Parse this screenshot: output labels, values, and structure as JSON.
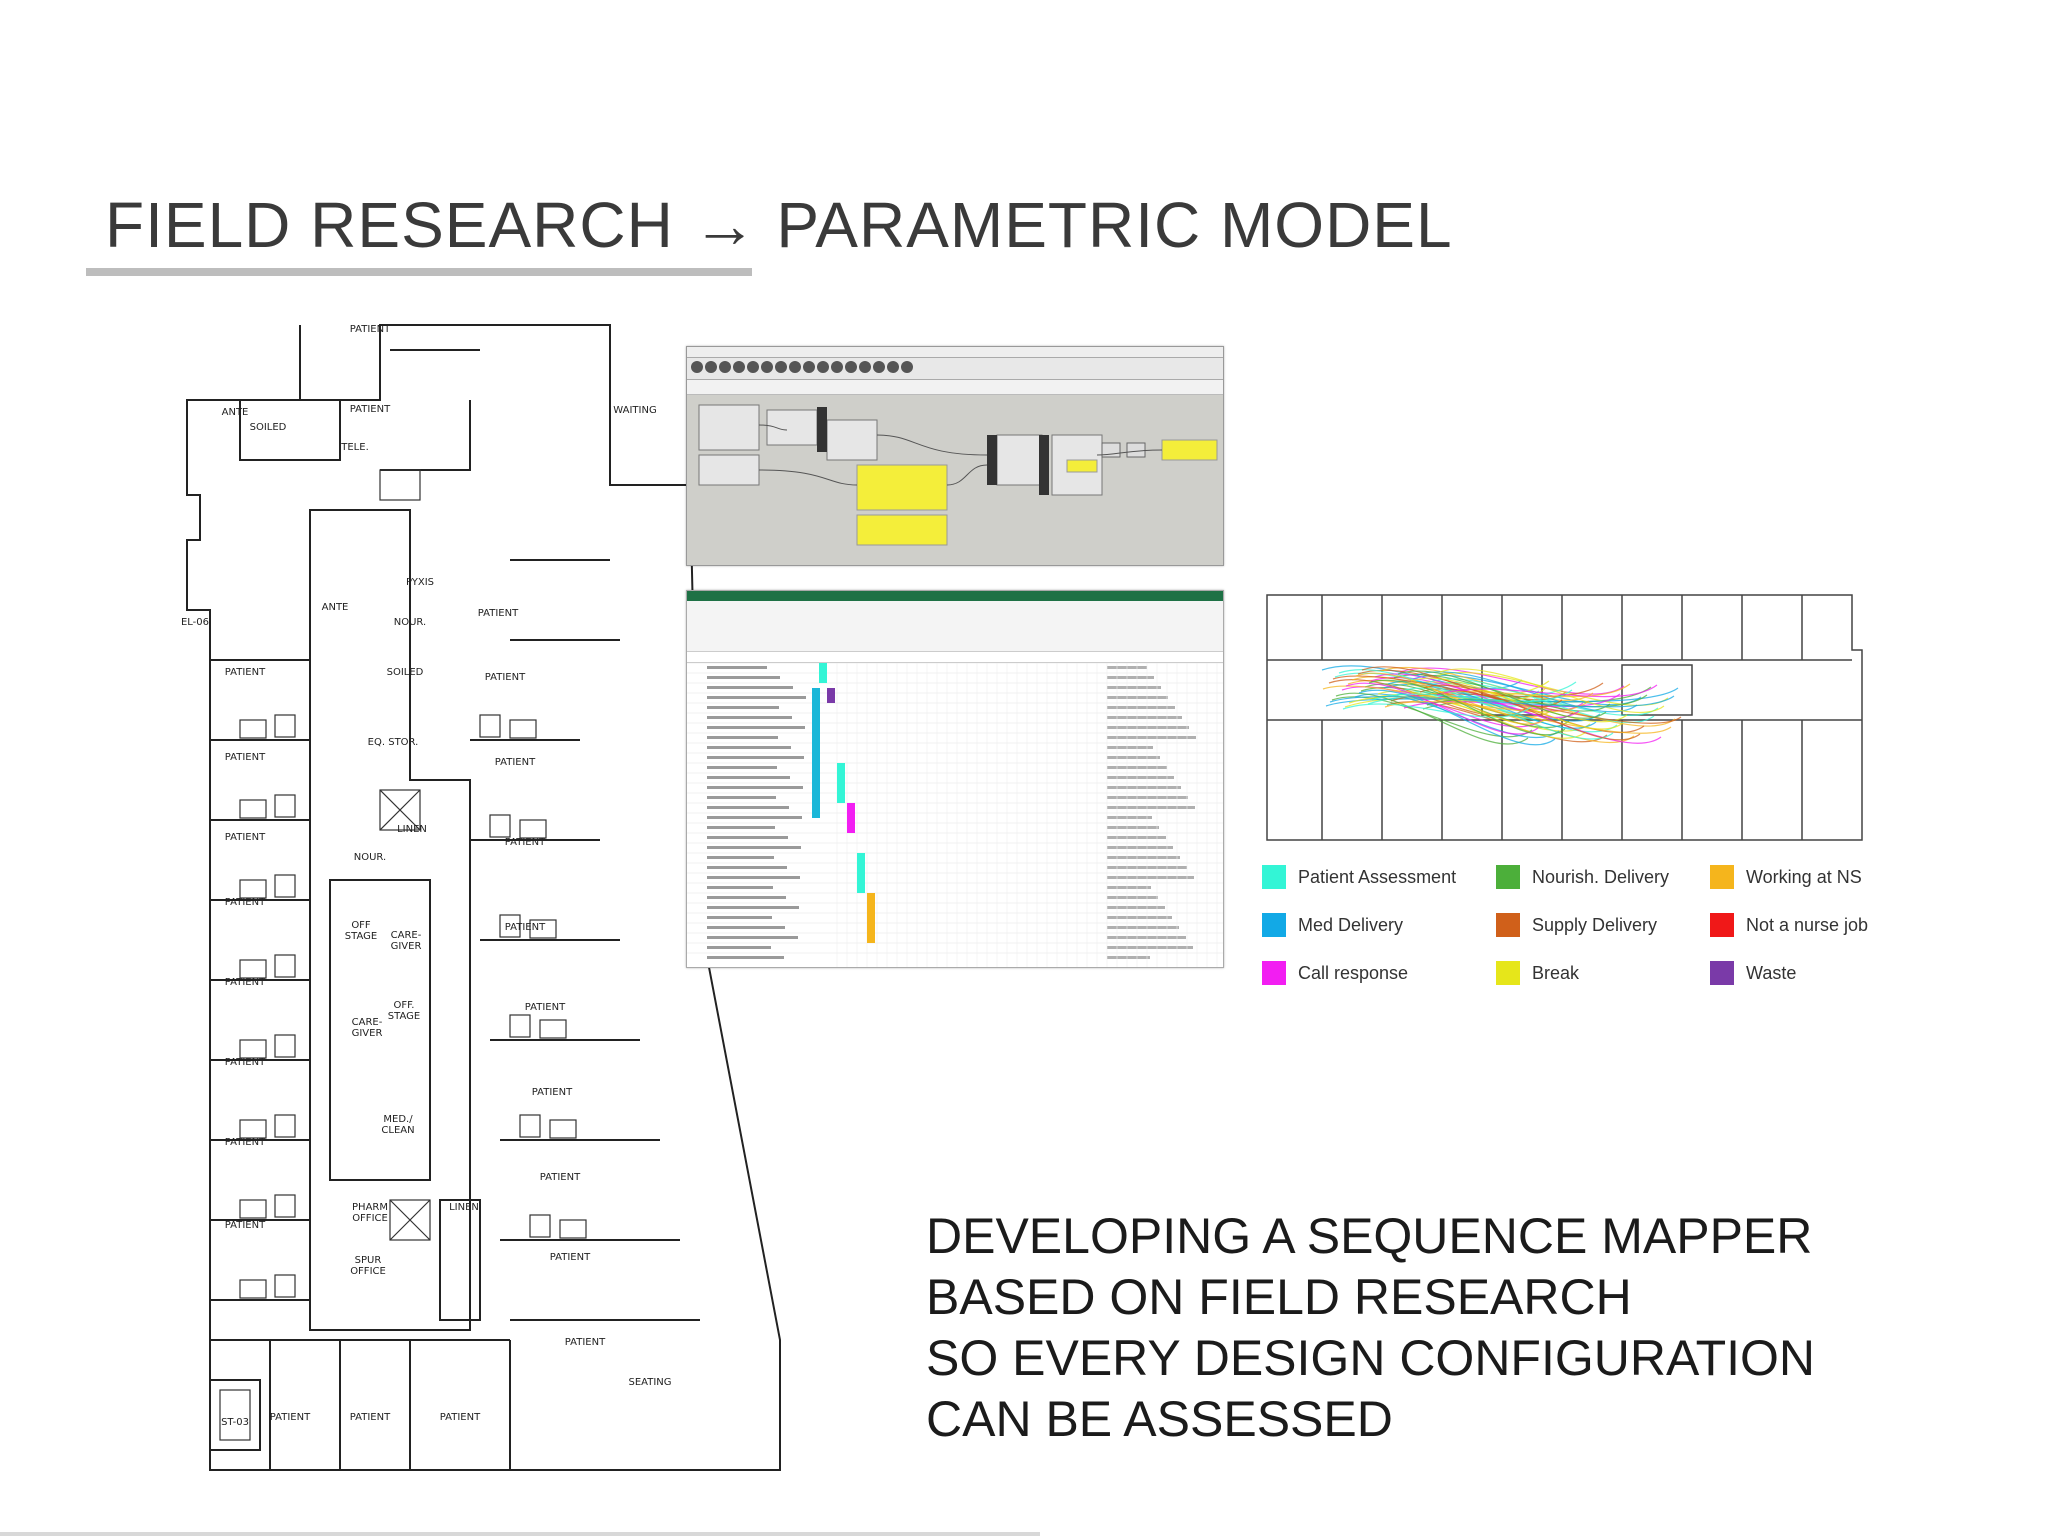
{
  "title": "FIELD RESEARCH → PARAMETRIC MODEL",
  "floorplan": {
    "labels": [
      "PATIENT",
      "PATIENT",
      "WAITING",
      "TELE.",
      "SOILED",
      "STOR.",
      "ANTE",
      "PYXIS",
      "NOUR.",
      "SOILED",
      "EQ. STOR.",
      "LINEN",
      "NOUR.",
      "OFF STAGE",
      "CARE-GIVER",
      "CARE-GIVER",
      "OFF. STAGE",
      "MED./ CLEAN",
      "PHARM OFFICE",
      "SPUR OFFICE",
      "LINEN",
      "SEATING",
      "ST-03",
      "PATIENT",
      "PATIENT",
      "PATIENT",
      "PATIENT",
      "PATIENT",
      "PATIENT",
      "PATIENT",
      "PATIENT",
      "PATIENT",
      "PATIENT",
      "PATIENT",
      "PATIENT",
      "PATIENT",
      "PATIENT",
      "PATIENT",
      "PATIENT",
      "PATIENT",
      "PATIENT",
      "PATIENT",
      "PATIENT",
      "EL-06"
    ]
  },
  "legend": [
    {
      "label": "Patient Assessment",
      "color": "#33f5d6"
    },
    {
      "label": "Nourish. Delivery",
      "color": "#4caf3a"
    },
    {
      "label": "Working at NS",
      "color": "#f5b51c"
    },
    {
      "label": "Med Delivery",
      "color": "#12a9e6"
    },
    {
      "label": "Supply Delivery",
      "color": "#d0601a"
    },
    {
      "label": "Not a nurse job",
      "color": "#f01818"
    },
    {
      "label": "Call response",
      "color": "#f21ef2"
    },
    {
      "label": "Break",
      "color": "#e6e61a"
    },
    {
      "label": "Waste",
      "color": "#7a3aa8"
    }
  ],
  "caption": [
    "DEVELOPING A SEQUENCE MAPPER",
    "BASED ON FIELD RESEARCH",
    "SO EVERY DESIGN CONFIGURATION",
    "CAN BE ASSESSED"
  ]
}
